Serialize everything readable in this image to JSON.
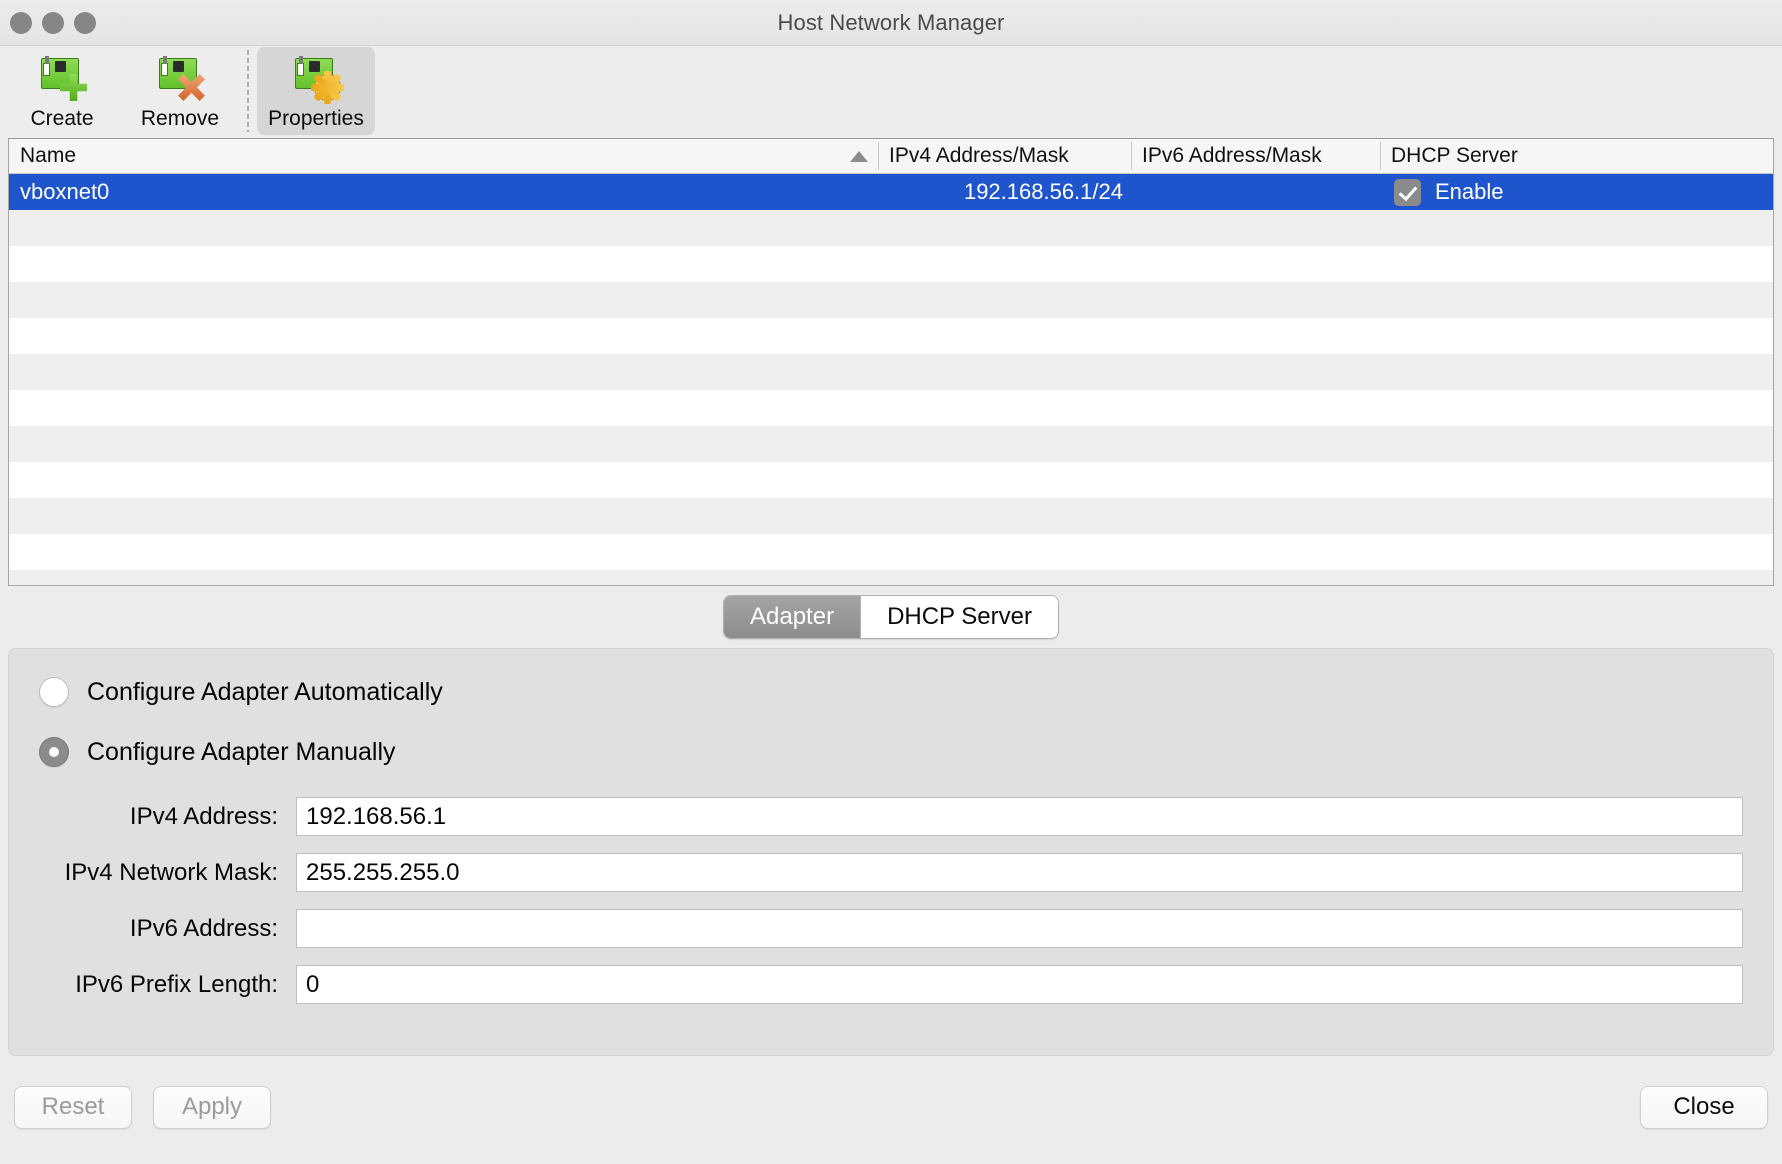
{
  "window": {
    "title": "Host Network Manager",
    "traffic_lights": [
      "close",
      "minimize",
      "zoom"
    ]
  },
  "toolbar": {
    "buttons": [
      {
        "label": "Create",
        "icon": "network-card-add-icon",
        "selected": false
      },
      {
        "label": "Remove",
        "icon": "network-card-remove-icon",
        "selected": false
      },
      {
        "label": "Properties",
        "icon": "network-card-settings-icon",
        "selected": true
      }
    ]
  },
  "table": {
    "columns": [
      {
        "key": "name",
        "label": "Name",
        "sorted": true,
        "sort_direction": "ascending"
      },
      {
        "key": "ipv4",
        "label": "IPv4 Address/Mask"
      },
      {
        "key": "ipv6",
        "label": "IPv6 Address/Mask"
      },
      {
        "key": "dhcp",
        "label": "DHCP Server"
      }
    ],
    "rows": [
      {
        "name": "vboxnet0",
        "ipv4": "192.168.56.1/24",
        "ipv6": "",
        "dhcp_checked": true,
        "dhcp_label": "Enable",
        "selected": true
      }
    ],
    "empty_row_count": 11
  },
  "tabs": [
    {
      "label": "Adapter",
      "active": true
    },
    {
      "label": "DHCP Server",
      "active": false
    }
  ],
  "adapter": {
    "radios": [
      {
        "label": "Configure Adapter Automatically",
        "selected": false
      },
      {
        "label": "Configure Adapter Manually",
        "selected": true
      }
    ],
    "fields": [
      {
        "label": "IPv4 Address:",
        "value": "192.168.56.1",
        "placeholder": ""
      },
      {
        "label": "IPv4 Network Mask:",
        "value": "255.255.255.0",
        "placeholder": ""
      },
      {
        "label": "IPv6 Address:",
        "value": "",
        "placeholder": ""
      },
      {
        "label": "IPv6 Prefix Length:",
        "value": "0",
        "placeholder": ""
      }
    ]
  },
  "footer": {
    "reset_label": "Reset",
    "reset_disabled": true,
    "apply_label": "Apply",
    "apply_disabled": true,
    "close_label": "Close"
  },
  "colors": {
    "selection_blue": "#1f55cc",
    "window_bg": "#ececec",
    "panel_bg": "#e0e0e0",
    "nic_green": "#62c12b"
  }
}
